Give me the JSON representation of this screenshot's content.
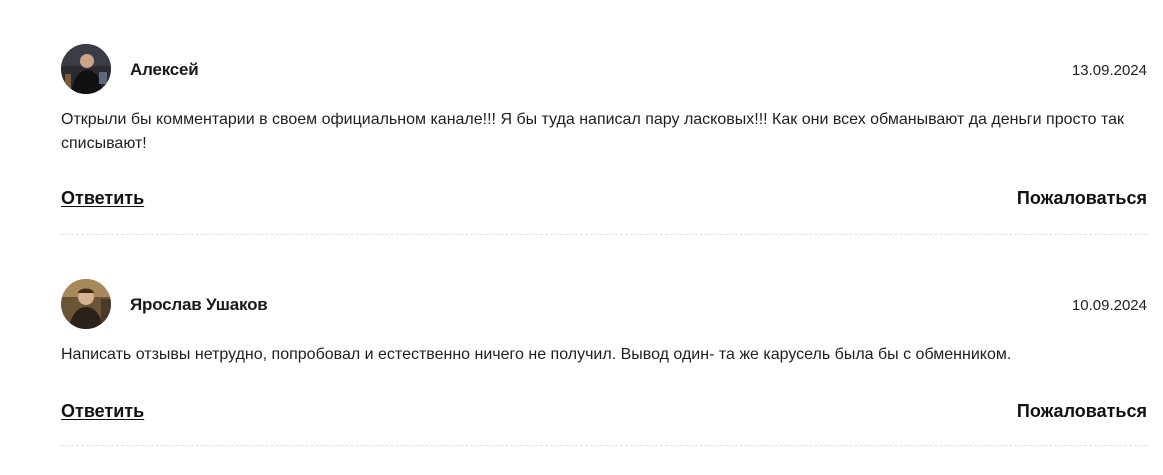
{
  "comments": [
    {
      "author": "Алексей",
      "date": "13.09.2024",
      "text": "Открыли бы комментарии в своем официальном канале!!! Я бы туда написал пару ласковых!!! Как они всех обманывают да деньги просто так списывают!",
      "reply_label": "Ответить",
      "report_label": "Пожаловаться"
    },
    {
      "author": "Ярослав Ушаков",
      "date": "10.09.2024",
      "text": "Написать отзывы нетрудно, попробовал и естественно ничего не получил. Вывод один- та же карусель была бы с обменником.",
      "reply_label": "Ответить",
      "report_label": "Пожаловаться"
    }
  ]
}
